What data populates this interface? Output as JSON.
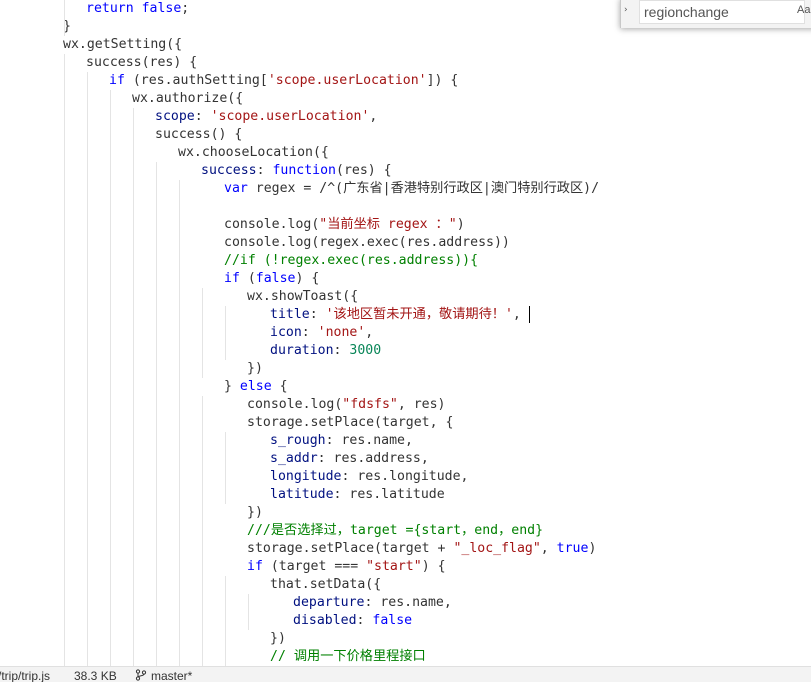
{
  "editor": {
    "lines": [
      [
        {
          "t": "return",
          "c": "kw"
        },
        {
          "t": " ",
          "c": "txt"
        },
        {
          "t": "false",
          "c": "kw"
        },
        {
          "t": ";",
          "c": "txt"
        }
      ],
      [
        {
          "t": "}",
          "c": "txt"
        }
      ],
      [
        {
          "t": "wx.getSetting({",
          "c": "txt"
        }
      ],
      [
        {
          "t": "success(res) {",
          "c": "txt"
        }
      ],
      [
        {
          "t": "if",
          "c": "kw"
        },
        {
          "t": " (res.authSetting[",
          "c": "txt"
        },
        {
          "t": "'scope.userLocation'",
          "c": "str"
        },
        {
          "t": "]) {",
          "c": "txt"
        }
      ],
      [
        {
          "t": "wx.authorize({",
          "c": "txt"
        }
      ],
      [
        {
          "t": "scope",
          "c": "prop"
        },
        {
          "t": ": ",
          "c": "txt"
        },
        {
          "t": "'scope.userLocation'",
          "c": "str"
        },
        {
          "t": ",",
          "c": "txt"
        }
      ],
      [
        {
          "t": "success() {",
          "c": "txt"
        }
      ],
      [
        {
          "t": "wx.chooseLocation({",
          "c": "txt"
        }
      ],
      [
        {
          "t": "success",
          "c": "prop"
        },
        {
          "t": ": ",
          "c": "txt"
        },
        {
          "t": "function",
          "c": "kw"
        },
        {
          "t": "(res) {",
          "c": "txt"
        }
      ],
      [
        {
          "t": "var",
          "c": "kw"
        },
        {
          "t": " regex = /^(广东省|香港特别行政区|澳门特别行政区)/",
          "c": "txt"
        }
      ],
      [],
      [
        {
          "t": "console.log(",
          "c": "txt"
        },
        {
          "t": "\"当前坐标 regex ：\"",
          "c": "str"
        },
        {
          "t": ")",
          "c": "txt"
        }
      ],
      [
        {
          "t": "console.log(regex.exec(res.address))",
          "c": "txt"
        }
      ],
      [
        {
          "t": "//if (!regex.exec(res.address)){",
          "c": "cmt"
        }
      ],
      [
        {
          "t": "if",
          "c": "kw"
        },
        {
          "t": " (",
          "c": "txt"
        },
        {
          "t": "false",
          "c": "kw"
        },
        {
          "t": ") {",
          "c": "txt"
        }
      ],
      [
        {
          "t": "wx.showToast({",
          "c": "txt"
        }
      ],
      [
        {
          "t": "title",
          "c": "prop"
        },
        {
          "t": ": ",
          "c": "txt"
        },
        {
          "t": "'该地区暂未开通，敬请期待！'",
          "c": "str"
        },
        {
          "t": ",",
          "c": "txt"
        }
      ],
      [
        {
          "t": "icon",
          "c": "prop"
        },
        {
          "t": ": ",
          "c": "txt"
        },
        {
          "t": "'none'",
          "c": "str"
        },
        {
          "t": ",",
          "c": "txt"
        }
      ],
      [
        {
          "t": "duration",
          "c": "prop"
        },
        {
          "t": ": ",
          "c": "txt"
        },
        {
          "t": "3000",
          "c": "num"
        }
      ],
      [
        {
          "t": "})",
          "c": "txt"
        }
      ],
      [
        {
          "t": "} ",
          "c": "txt"
        },
        {
          "t": "else",
          "c": "kw"
        },
        {
          "t": " {",
          "c": "txt"
        }
      ],
      [
        {
          "t": "console.log(",
          "c": "txt"
        },
        {
          "t": "\"fdsfs\"",
          "c": "str"
        },
        {
          "t": ", res)",
          "c": "txt"
        }
      ],
      [
        {
          "t": "storage.setPlace(target, {",
          "c": "txt"
        }
      ],
      [
        {
          "t": "s_rough",
          "c": "prop"
        },
        {
          "t": ": res.name,",
          "c": "txt"
        }
      ],
      [
        {
          "t": "s_addr",
          "c": "prop"
        },
        {
          "t": ": res.address,",
          "c": "txt"
        }
      ],
      [
        {
          "t": "longitude",
          "c": "prop"
        },
        {
          "t": ": res.longitude,",
          "c": "txt"
        }
      ],
      [
        {
          "t": "latitude",
          "c": "prop"
        },
        {
          "t": ": res.latitude",
          "c": "txt"
        }
      ],
      [
        {
          "t": "})",
          "c": "txt"
        }
      ],
      [
        {
          "t": "///是否选择过，target ={start，end，end}",
          "c": "cmt"
        }
      ],
      [
        {
          "t": "storage.setPlace(target + ",
          "c": "txt"
        },
        {
          "t": "\"_loc_flag\"",
          "c": "str"
        },
        {
          "t": ", ",
          "c": "txt"
        },
        {
          "t": "true",
          "c": "kw"
        },
        {
          "t": ")",
          "c": "txt"
        }
      ],
      [
        {
          "t": "if",
          "c": "kw"
        },
        {
          "t": " (target === ",
          "c": "txt"
        },
        {
          "t": "\"start\"",
          "c": "str"
        },
        {
          "t": ") {",
          "c": "txt"
        }
      ],
      [
        {
          "t": "that.setData({",
          "c": "txt"
        }
      ],
      [
        {
          "t": "departure",
          "c": "prop"
        },
        {
          "t": ": res.name,",
          "c": "txt"
        }
      ],
      [
        {
          "t": "disabled",
          "c": "prop"
        },
        {
          "t": ": ",
          "c": "txt"
        },
        {
          "t": "false",
          "c": "kw"
        }
      ],
      [
        {
          "t": "})",
          "c": "txt"
        }
      ],
      [
        {
          "t": "// 调用一下价格里程接口",
          "c": "cmt"
        }
      ]
    ]
  },
  "find_widget": {
    "toggle_glyph": "›",
    "search_value": "regionchange",
    "match_case_label": "Aa"
  },
  "status_bar": {
    "file_path": "/trip/trip.js",
    "file_size": "38.3 KB",
    "branch_icon": "git-branch-icon",
    "branch": "master*"
  }
}
